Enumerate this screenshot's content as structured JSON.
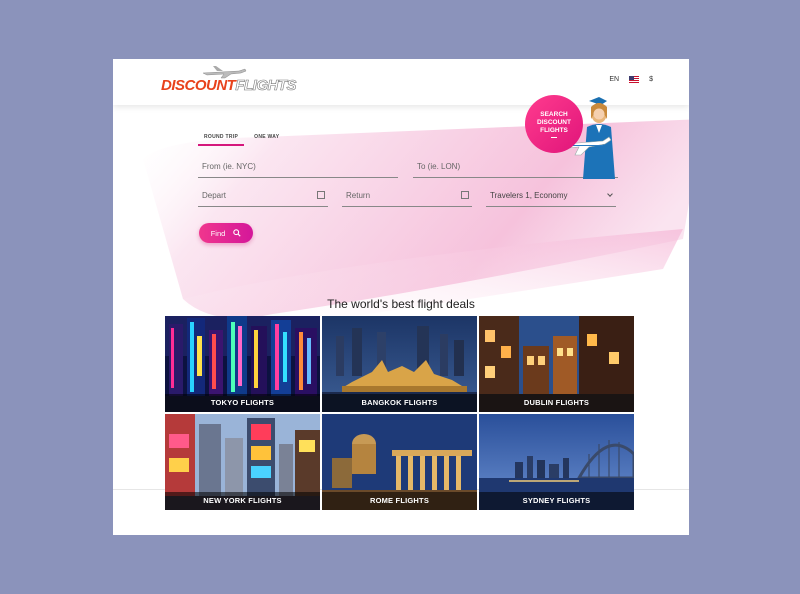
{
  "brand": {
    "logo_part1": "DISCOUNT",
    "logo_part2": "FLIGHTS"
  },
  "header": {
    "language": "EN",
    "currency": "$"
  },
  "search": {
    "tabs": [
      {
        "label": "ROUND TRIP",
        "active": true
      },
      {
        "label": "ONE WAY",
        "active": false
      }
    ],
    "from_placeholder": "From (ie. NYC)",
    "to_placeholder": "To (ie. LON)",
    "depart_placeholder": "Depart",
    "return_placeholder": "Return",
    "travelers_value": "Travelers 1, Economy",
    "find_label": "Find"
  },
  "promo": {
    "line1": "SEARCH",
    "line2": "DISCOUNT",
    "line3": "FLIGHTS"
  },
  "deals": {
    "title": "The world's best flight deals",
    "tiles": [
      {
        "label": "TOKYO FLIGHTS"
      },
      {
        "label": "BANGKOK FLIGHTS"
      },
      {
        "label": "DUBLIN FLIGHTS"
      },
      {
        "label": "NEW YORK FLIGHTS"
      },
      {
        "label": "ROME FLIGHTS"
      },
      {
        "label": "SYDNEY FLIGHTS"
      }
    ]
  },
  "colors": {
    "brand_orange": "#e8421c",
    "accent_pink": "#d5177c",
    "page_bg": "#8b93bb"
  }
}
